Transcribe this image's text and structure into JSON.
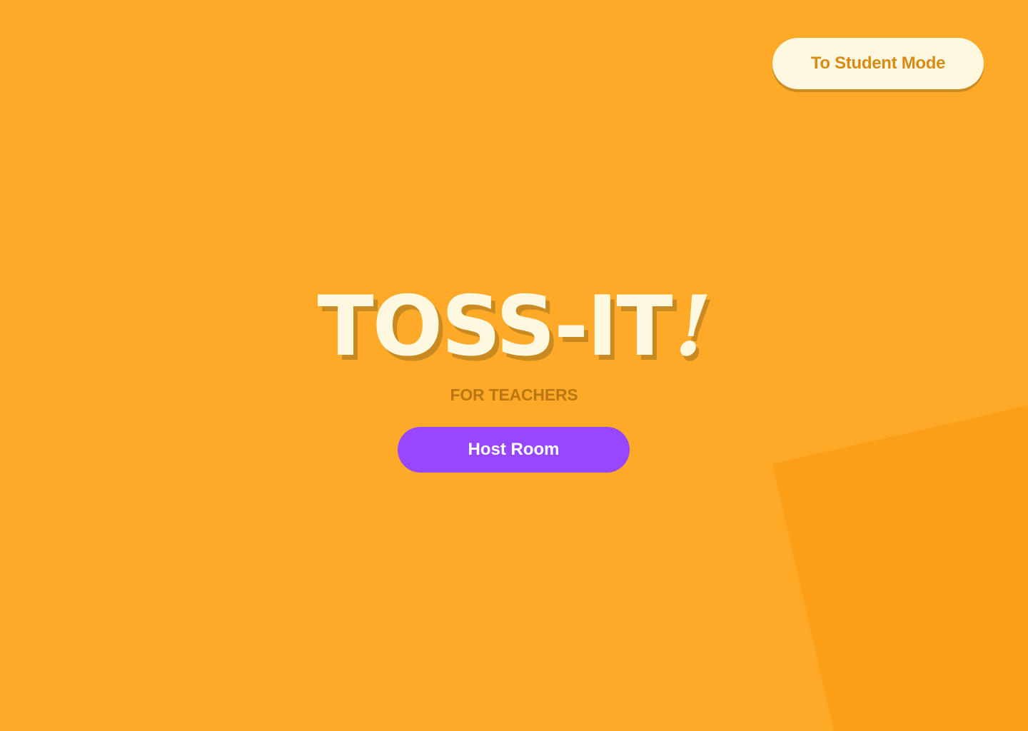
{
  "header": {
    "mode_switch_label": "To Student Mode"
  },
  "hero": {
    "title": "TOSS-IT",
    "title_punctuation": "!",
    "subtitle": "FOR TEACHERS",
    "primary_action_label": "Host Room"
  },
  "colors": {
    "background": "#FFA928",
    "background_shape": "#FB9E18",
    "cream": "#FFF8E1",
    "title_shadow": "#C98A22",
    "subtitle_text": "#B97711",
    "mode_button_text": "#D88A12",
    "primary_button": "#9747FF"
  }
}
